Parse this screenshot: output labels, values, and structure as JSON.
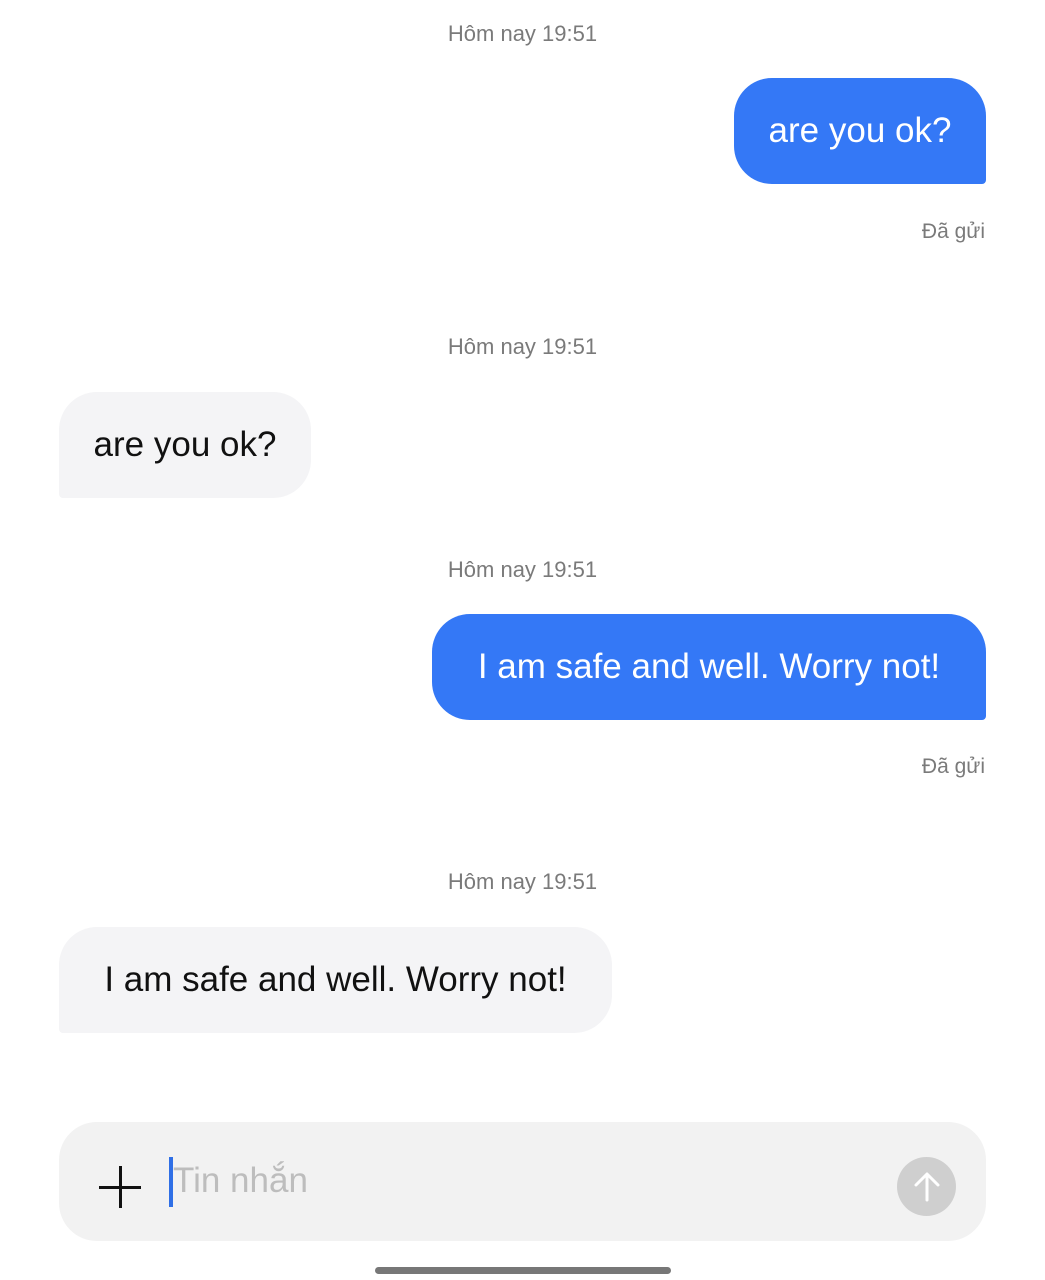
{
  "messages": [
    {
      "timestamp": "Hôm nay 19:51",
      "direction": "outgoing",
      "text": "are you ok?",
      "status": "Đã gửi"
    },
    {
      "timestamp": "Hôm nay 19:51",
      "direction": "incoming",
      "text": "are you ok?"
    },
    {
      "timestamp": "Hôm nay 19:51",
      "direction": "outgoing",
      "text": "I am safe and well. Worry not!",
      "status": "Đã gửi"
    },
    {
      "timestamp": "Hôm nay 19:51",
      "direction": "incoming",
      "text": "I am safe and well. Worry not!"
    }
  ],
  "composer": {
    "placeholder": "Tin nhắn",
    "value": "",
    "add_icon": "plus-icon",
    "send_icon": "arrow-up-icon"
  },
  "colors": {
    "outgoing_bubble": "#3478f6",
    "incoming_bubble": "#f4f4f6",
    "meta_text": "#7a7a7a",
    "send_button": "#cfcfcf"
  }
}
